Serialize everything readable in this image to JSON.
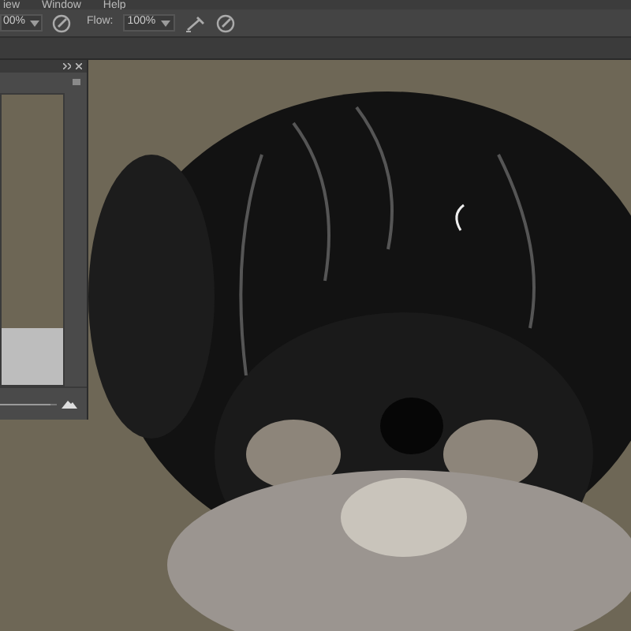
{
  "menu": [
    {
      "label": "iew"
    },
    {
      "label": "Window"
    },
    {
      "label": "Help"
    }
  ],
  "options_bar": {
    "opacity": {
      "value": "00%"
    },
    "flow": {
      "label": "Flow:",
      "value": "100%"
    }
  },
  "navigator_panel": {
    "zoom_slider": {
      "level": 0.9
    }
  }
}
